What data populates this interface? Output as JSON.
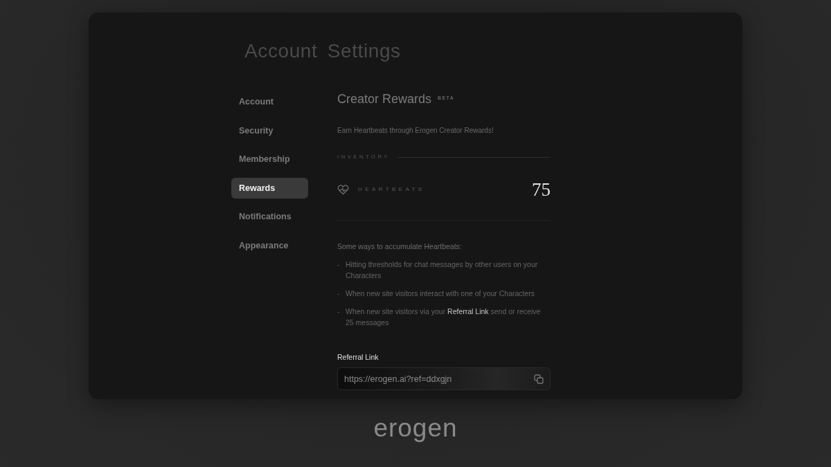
{
  "title": "Account Settings",
  "sidebar": {
    "items": [
      {
        "label": "Account",
        "selected": false
      },
      {
        "label": "Security",
        "selected": false
      },
      {
        "label": "Membership",
        "selected": false
      },
      {
        "label": "Rewards",
        "selected": true
      },
      {
        "label": "Notifications",
        "selected": false
      },
      {
        "label": "Appearance",
        "selected": false
      }
    ]
  },
  "section": {
    "title": "Creator Rewards",
    "badge": "BETA",
    "description": "Earn Heartbeats through Erogen Creator Rewards!",
    "inventory": {
      "label": "INVENTORY",
      "items": [
        {
          "label": "HEARTBEATS",
          "value": "75"
        }
      ]
    },
    "ways": {
      "intro": "Some ways to accumulate Heartbeats:",
      "items": [
        {
          "marker": "-",
          "text": "Hitting thresholds for chat messages by other users on your Characters"
        },
        {
          "marker": "-",
          "text": "When new site visitors interact with one of your Characters"
        },
        {
          "marker": "-",
          "text": "When new site visitors via your **Referral Link** send or receive 25 messages"
        }
      ]
    },
    "referral": {
      "label": "Referral Link",
      "value": "https://erogen.ai?ref=ddxgjn"
    }
  },
  "logo": "erogen"
}
